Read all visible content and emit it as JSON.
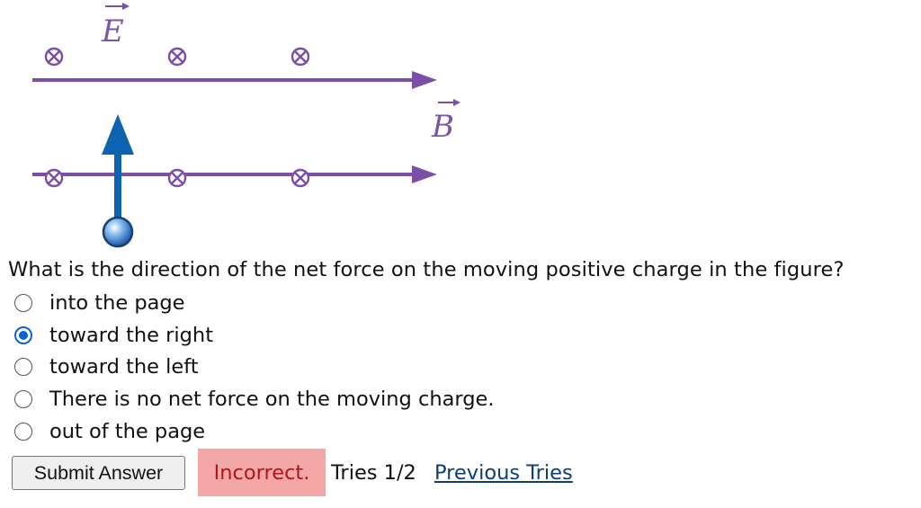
{
  "figure": {
    "e_label": "E",
    "b_label": "B",
    "colors": {
      "field": "#7b4fa6",
      "velocity": "#0d63b0",
      "charge_fill": "#4a8fd4"
    },
    "icons": {
      "e_field_symbol": "circle-x-icon (into page)",
      "b_field_arrow": "right-arrow-icon",
      "velocity_arrow": "up-arrow-icon",
      "charge": "sphere-icon"
    }
  },
  "question": {
    "prompt": "What is the direction of the net force on the moving positive charge in the figure?",
    "options": [
      {
        "label": "into the page",
        "selected": false
      },
      {
        "label": "toward the right",
        "selected": true
      },
      {
        "label": "toward the left",
        "selected": false
      },
      {
        "label": "There is no net force on the moving charge.",
        "selected": false
      },
      {
        "label": "out of the page",
        "selected": false
      }
    ]
  },
  "actions": {
    "submit_label": "Submit Answer"
  },
  "feedback": {
    "status": "Incorrect.",
    "tries": "Tries 1/2",
    "previous_tries_link": "Previous Tries",
    "status_bg": "#f4a7a7",
    "status_color": "#b0141e"
  }
}
